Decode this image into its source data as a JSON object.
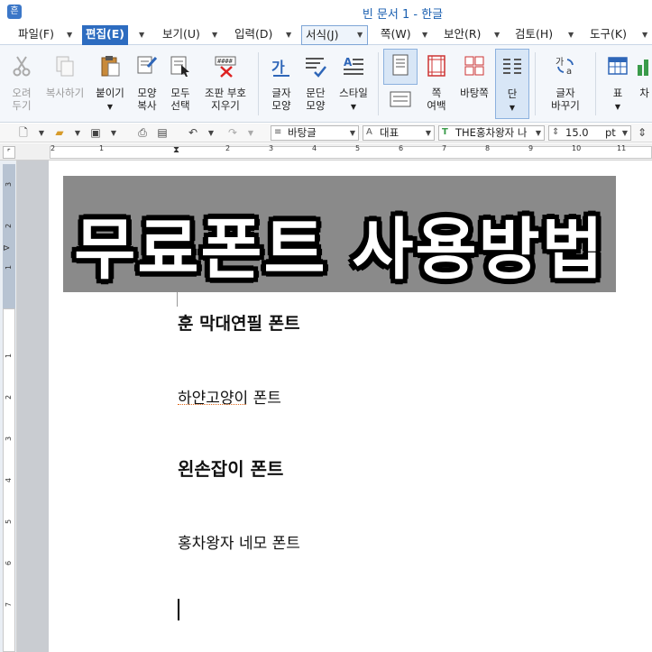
{
  "window": {
    "title": "빈 문서 1 - 한글",
    "app_icon_letter": "흔"
  },
  "menu": {
    "items": [
      "파일(F)",
      "편집(E)",
      "보기(U)",
      "입력(D)",
      "서식(J)",
      "쪽(W)",
      "보안(R)",
      "검토(H)",
      "도구(K)"
    ],
    "active": "편집(E)"
  },
  "ribbon": {
    "cut": "오려\n두기",
    "copy": "복사하기",
    "paste": "붙이기",
    "format_copy": "모양\n복사",
    "select_all": "모두\n선택",
    "delete_code": "조판 부호\n지우기",
    "char_shape": "글자\n모양",
    "para_shape": "문단\n모양",
    "style": "스타일",
    "page_margin": "쪽\n여백",
    "background_page": "바탕쪽",
    "column": "단",
    "char_replace": "글자\n바꾸기",
    "table": "표",
    "chart": "차"
  },
  "toolbar": {
    "style_value": "바탕글",
    "lang_value": "대표",
    "font_value": "THE홍차왕자 나",
    "size_value": "15.0",
    "size_unit": "pt"
  },
  "ruler": {
    "h_numbers": [
      "2",
      "1",
      "1",
      "2",
      "3",
      "4",
      "5",
      "6",
      "7",
      "8",
      "9",
      "10",
      "11"
    ],
    "v_numbers": [
      "3",
      "2",
      "1",
      "1",
      "2",
      "3",
      "4",
      "5",
      "6",
      "7"
    ]
  },
  "document": {
    "banner_text": "무료폰트 사용방법",
    "lines": [
      "훈 막대연필 폰트",
      "하얀고양이 폰트",
      "왼손잡이 폰트",
      "홍차왕자 네모 폰트"
    ]
  }
}
